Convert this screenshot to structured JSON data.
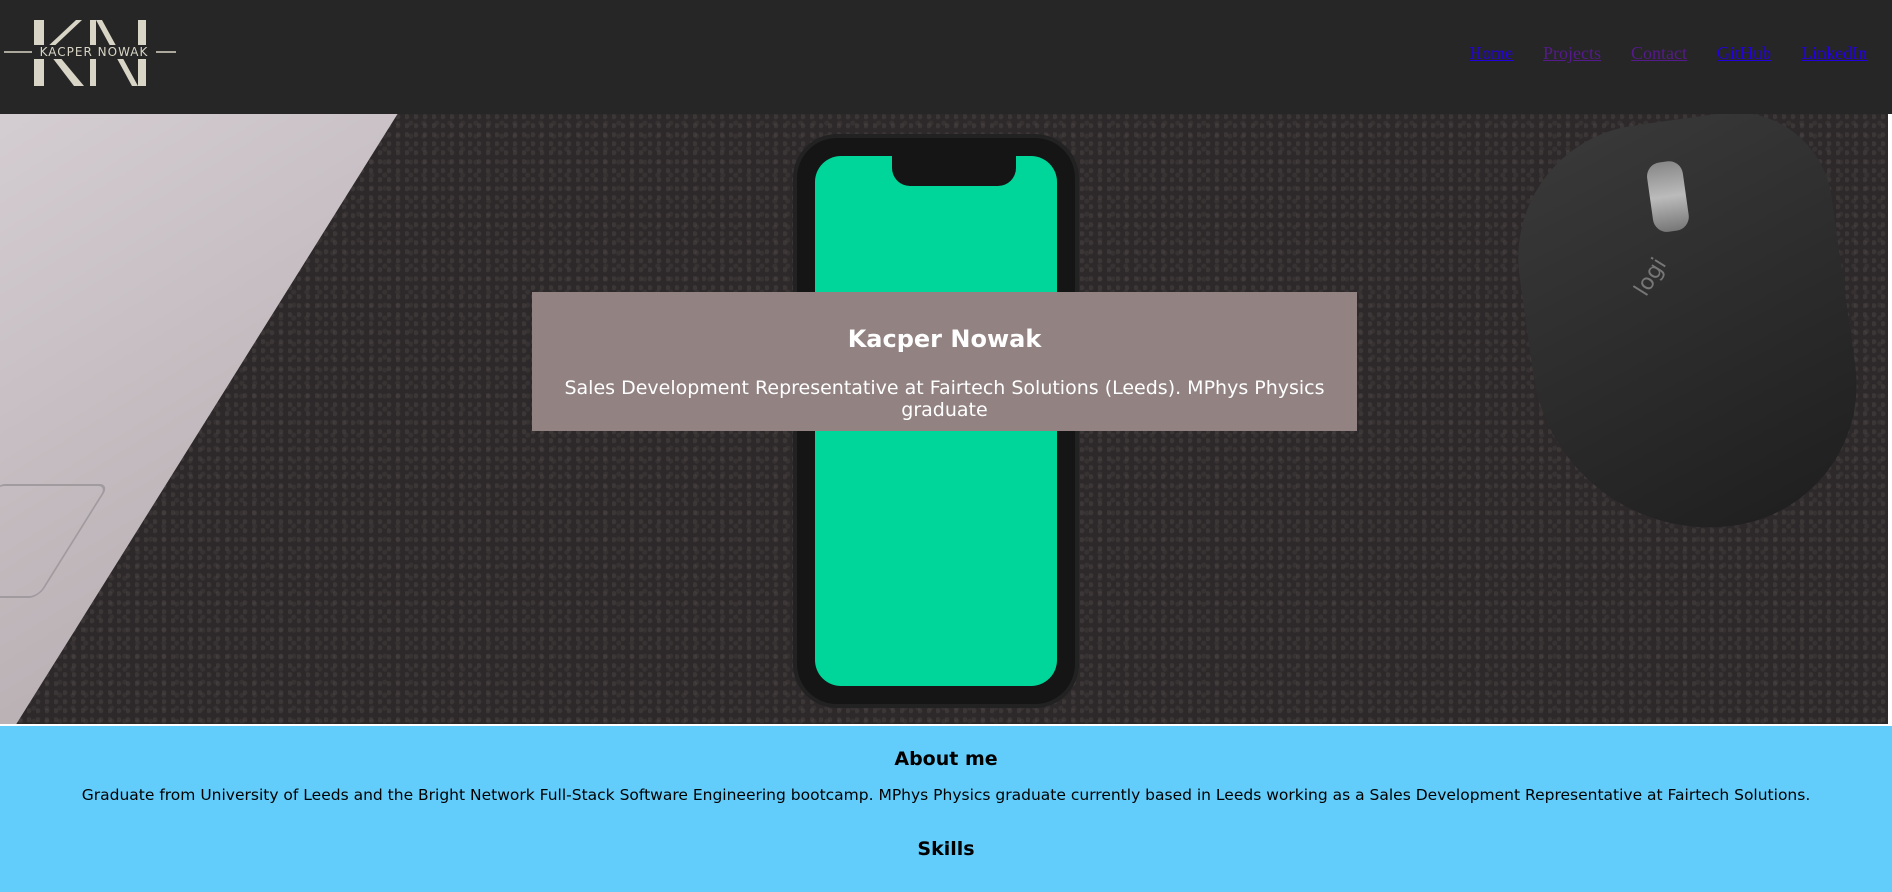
{
  "header": {
    "logo": {
      "monogram": "KN",
      "text": "KACPER NOWAK"
    },
    "nav": [
      {
        "label": "Home",
        "state": "unvisited"
      },
      {
        "label": "Projects",
        "state": "visited"
      },
      {
        "label": "Contact",
        "state": "visited"
      },
      {
        "label": "GitHub",
        "state": "unvisited"
      },
      {
        "label": "LinkedIn",
        "state": "unvisited"
      }
    ]
  },
  "hero": {
    "name": "Kacper Nowak",
    "subtitle": "Sales Development Representative at Fairtech Solutions (Leeds). MPhys Physics graduate",
    "background_icons": [
      "laptop-image",
      "phone-image",
      "mouse-image"
    ]
  },
  "about": {
    "heading": "About me",
    "body": "Graduate from University of Leeds and the Bright Network Full-Stack Software Engineering bootcamp. MPhys Physics graduate currently based in Leeds working as a Sales Development Representative at Fairtech Solutions.",
    "skills_heading": "Skills"
  },
  "colors": {
    "header_bg": "#262626",
    "hero_card_bg": "#928282",
    "about_bg": "#62cdfa",
    "phone_screen": "#00d69a",
    "link_unvisited": "#2200dd",
    "link_visited": "#551a8b"
  }
}
